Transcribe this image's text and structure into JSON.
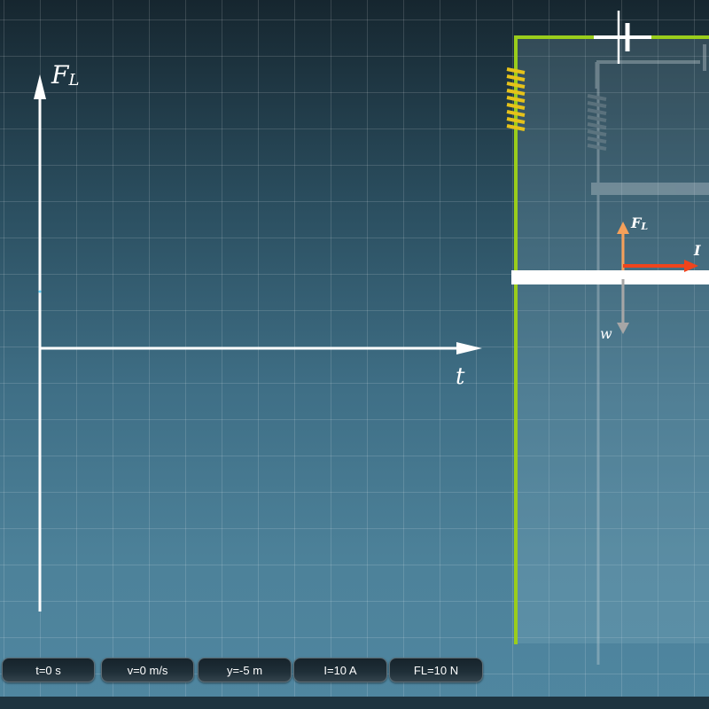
{
  "graph": {
    "y_axis_label": "F",
    "y_axis_sub": "L",
    "x_axis_label": "t"
  },
  "circuit": {
    "force_label": "F",
    "force_sub": "L",
    "current_label": "I",
    "weight_label": "w"
  },
  "readouts": [
    {
      "label": "t=0 s"
    },
    {
      "label": "v=0 m/s"
    },
    {
      "label": "y=-5 m"
    },
    {
      "label": "I=10 A"
    },
    {
      "label": "FL=10 N"
    }
  ],
  "colors": {
    "wire": "#9acd1c",
    "spring": "#e6c21a",
    "force_arrow": "#f5a05a",
    "current_arrow": "#f0441c",
    "weight_arrow": "#a6a6a6",
    "rod": "#ffffff"
  }
}
